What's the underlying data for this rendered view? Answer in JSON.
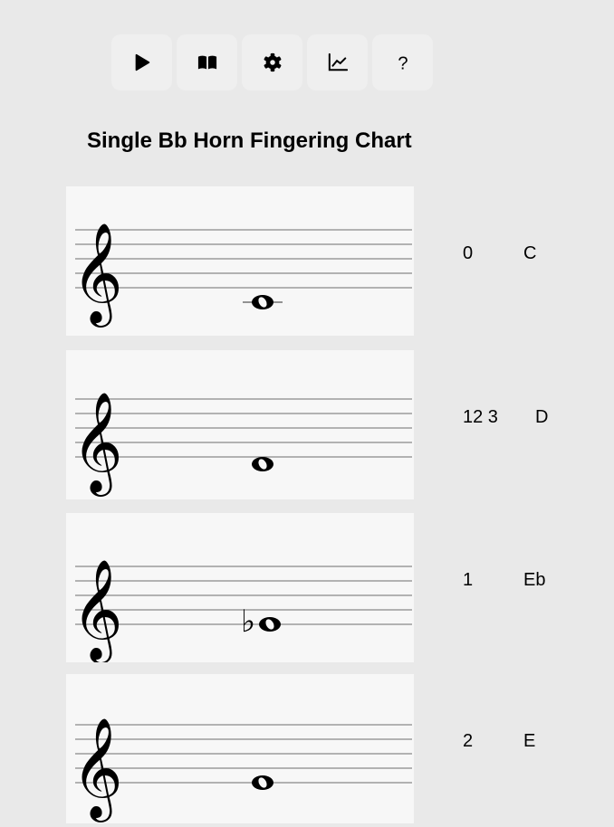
{
  "toolbar": {
    "buttons": [
      {
        "name": "play-button",
        "icon": "play-icon"
      },
      {
        "name": "book-button",
        "icon": "book-icon"
      },
      {
        "name": "settings-button",
        "icon": "gear-icon"
      },
      {
        "name": "stats-button",
        "icon": "chart-icon"
      },
      {
        "name": "help-button",
        "icon": "help-icon"
      }
    ]
  },
  "title": "Single Bb Horn Fingering Chart",
  "rows": [
    {
      "fingering": "0",
      "note": "C"
    },
    {
      "fingering": "12 3",
      "note": "D"
    },
    {
      "fingering": "1",
      "note": "Eb"
    },
    {
      "fingering": "2",
      "note": "E"
    }
  ]
}
